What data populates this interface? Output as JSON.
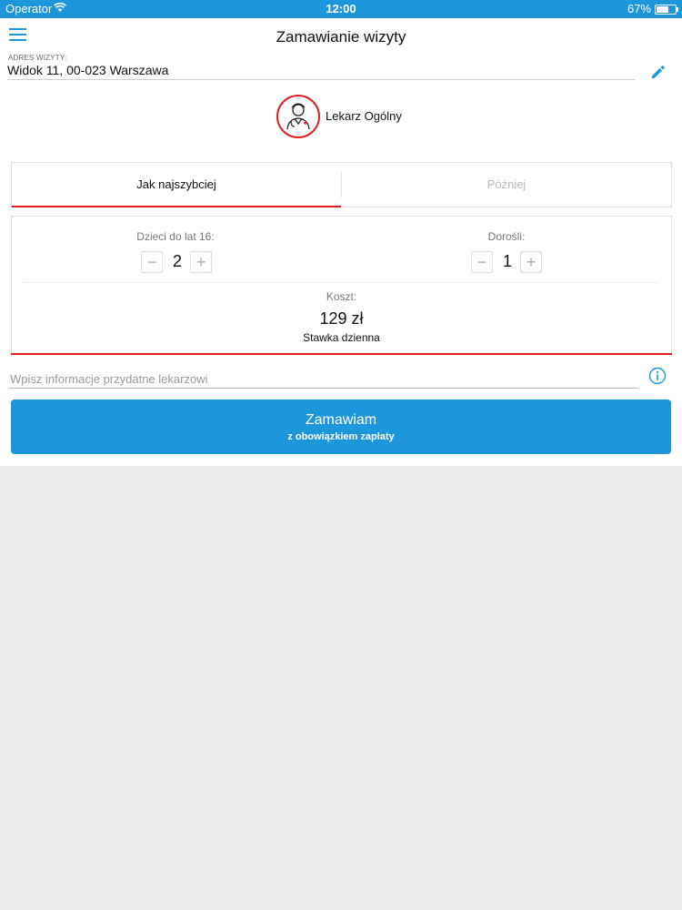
{
  "status_bar": {
    "carrier": "Operator",
    "time": "12:00",
    "battery": "67%",
    "battery_level": 0.67
  },
  "header": {
    "title": "Zamawianie wizyty",
    "menu_icon": "hamburger-menu-icon"
  },
  "address": {
    "label": "ADRES WIZYTY:",
    "value": "Widok 11, 00-023 Warszawa",
    "edit_icon": "pencil-icon"
  },
  "doctor": {
    "label": "Lekarz Ogólny",
    "icon": "doctor-icon"
  },
  "tabs": [
    {
      "label": "Jak najszybciej",
      "active": true
    },
    {
      "label": "Później",
      "active": false
    }
  ],
  "counts": {
    "children_label": "Dzieci do lat 16:",
    "children_value": "2",
    "adults_label": "Dorośli:",
    "adults_value": "1",
    "minus": "−",
    "plus": "+"
  },
  "cost": {
    "label": "Koszt:",
    "value": "129 zł",
    "rate": "Stawka dzienna"
  },
  "note": {
    "placeholder": "Wpisz informacje przydatne lekarzowi",
    "value": "",
    "info_icon": "info-icon"
  },
  "order_button": {
    "label": "Zamawiam",
    "sublabel": "z obowiązkiem zapłaty"
  },
  "colors": {
    "accent": "#1e96dc",
    "highlight": "#dd2222"
  }
}
